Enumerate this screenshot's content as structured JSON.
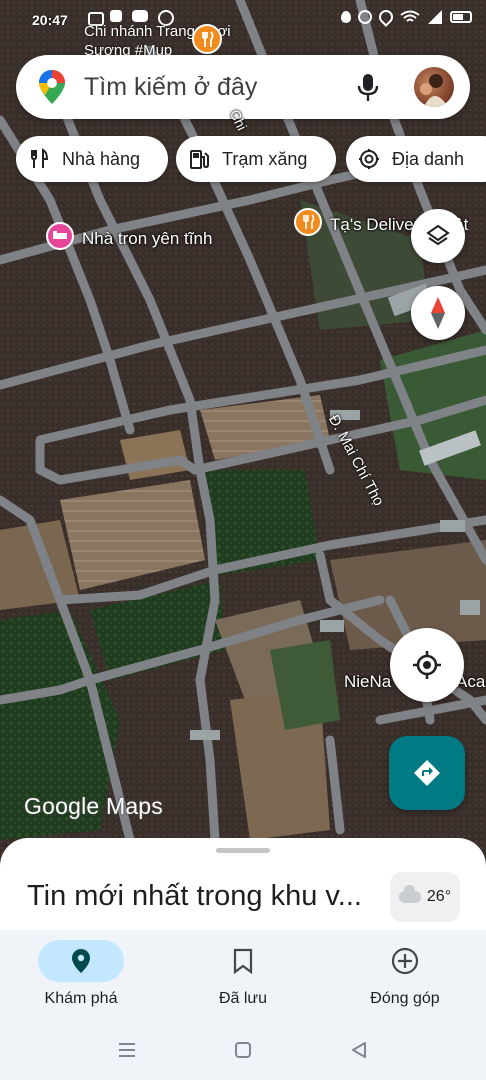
{
  "status_bar": {
    "time": "20:47"
  },
  "search": {
    "placeholder": "Tìm kiếm ở đây"
  },
  "chips": [
    {
      "label": "Nhà hàng",
      "icon": "restaurant-icon"
    },
    {
      "label": "Trạm xăng",
      "icon": "gas-station-icon"
    },
    {
      "label": "Địa danh",
      "icon": "landmark-icon"
    }
  ],
  "map": {
    "poi_top": "Trang Phơi\nSương #Mup",
    "poi_top_prefix": "Chi nhánh",
    "hotel": "Nhà tron yên tĩnh",
    "delivery": "Tạ's Delivery - Vật",
    "street": "Đ. Mai Chí Thọ",
    "place_partial": "NieNa",
    "place_partial2": "Aca",
    "road_partial": "Chi",
    "attribution": "Google Maps"
  },
  "sheet": {
    "title": "Tin mới nhất trong khu v...",
    "weather": "26°"
  },
  "nav": [
    {
      "label": "Khám phá",
      "icon": "explore-pin-icon",
      "active": true
    },
    {
      "label": "Đã lưu",
      "icon": "bookmark-icon",
      "active": false
    },
    {
      "label": "Đóng góp",
      "icon": "add-circle-icon",
      "active": false
    }
  ],
  "colors": {
    "accent": "#007b83",
    "active_pill": "#c2e7ff",
    "poi_orange": "#f28b1e",
    "hotel_pink": "#e7479a"
  }
}
